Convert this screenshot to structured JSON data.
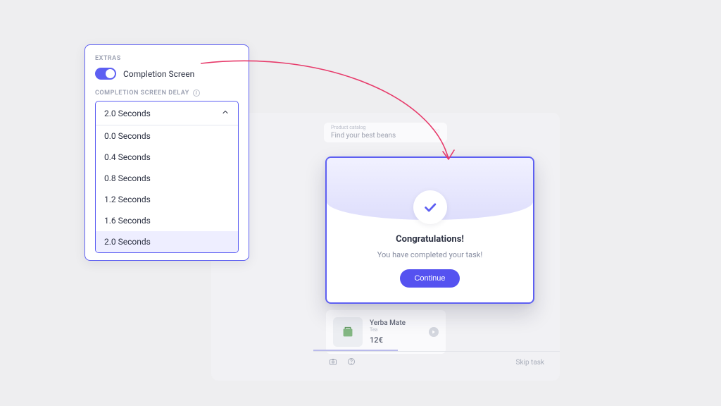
{
  "panel": {
    "section_label": "EXTRAS",
    "toggle_label": "Completion Screen",
    "delay_label": "COMPLETION SCREEN DELAY",
    "select_current": "2.0 Seconds",
    "options": [
      "0.0 Seconds",
      "0.4 Seconds",
      "0.8 Seconds",
      "1.2 Seconds",
      "1.6 Seconds",
      "2.0 Seconds"
    ]
  },
  "modal": {
    "title": "Congratulations!",
    "subtitle": "You have completed your task!",
    "button": "Continue"
  },
  "bg": {
    "search_sub": "Product catalog",
    "search_placeholder": "Find your best beans",
    "card_name": "Yerba Mate",
    "card_sub": "Tea",
    "card_price": "12€",
    "skip": "Skip task"
  },
  "colors": {
    "accent": "#5d5ff2",
    "arrow": "#e73b6b"
  }
}
